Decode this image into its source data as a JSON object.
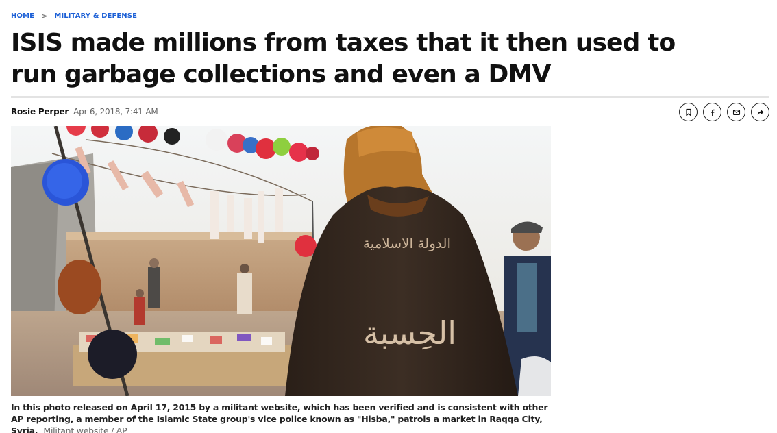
{
  "breadcrumb": {
    "home": "HOME",
    "separator": ">",
    "section": "MILITARY & DEFENSE"
  },
  "article": {
    "headline": "ISIS made millions from taxes that it then used to run garbage collections and even a DMV",
    "author": "Rosie Perper",
    "date": "Apr 6, 2018, 7:41 AM"
  },
  "share": {
    "buttons": [
      "bookmark-icon",
      "facebook-icon",
      "email-icon",
      "share-arrow-icon"
    ]
  },
  "photo": {
    "vest_text_top": "الدولة الاسلامية",
    "vest_text_bottom": "الحِسبة"
  },
  "caption": {
    "text": "In this photo released on April 17, 2015 by a militant website, which has been verified and is consistent with other AP reporting, a member of the Islamic State group's vice police known as \"Hisba,\" patrols a market in Raqqa City, Syria.",
    "credit": "Militant website / AP"
  },
  "colors": {
    "link_blue": "#1b5fd6",
    "rule_gray": "#e3e3e3",
    "text_dark": "#111111"
  }
}
